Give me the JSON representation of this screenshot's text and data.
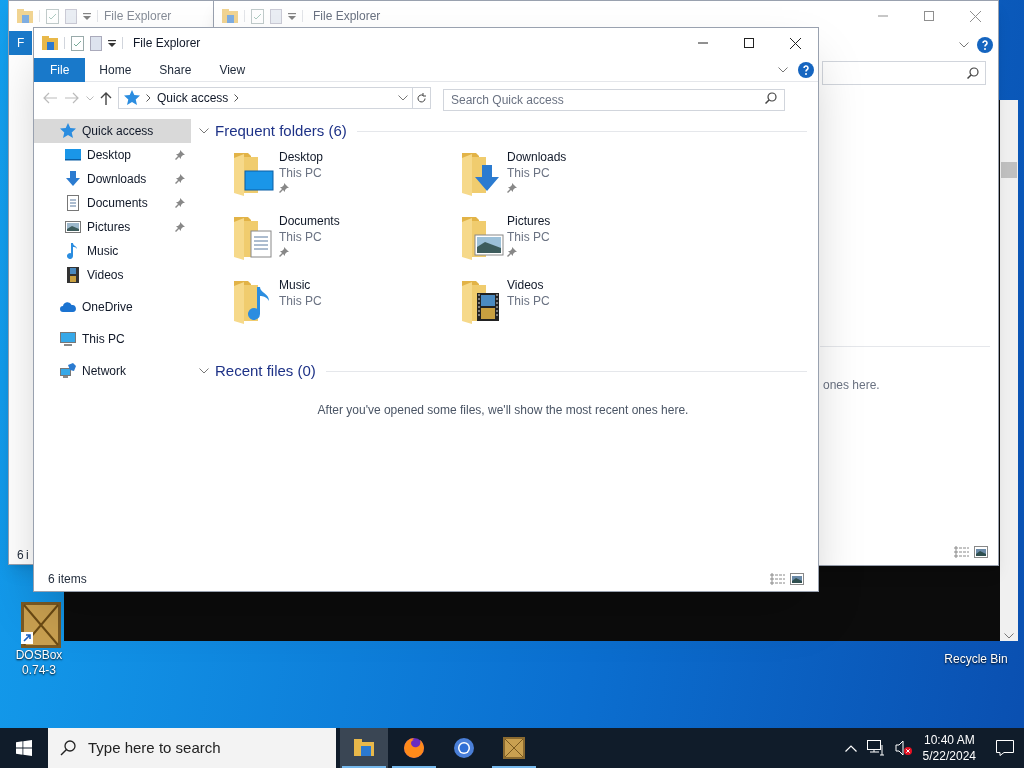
{
  "background_windows": [
    {
      "title": "File Explorer",
      "ribbon_tab": "F",
      "status": "6 i"
    },
    {
      "title": "File Explorer",
      "content_text": "ones here."
    }
  ],
  "window": {
    "title": "File Explorer"
  },
  "ribbon_tabs": [
    {
      "label": "File",
      "selected": true
    },
    {
      "label": "Home",
      "selected": false
    },
    {
      "label": "Share",
      "selected": false
    },
    {
      "label": "View",
      "selected": false
    }
  ],
  "address": {
    "path": "Quick access"
  },
  "search": {
    "placeholder": "Search Quick access"
  },
  "nav": [
    {
      "label": "Quick access",
      "kind": "quick",
      "selected": true,
      "children": [
        {
          "label": "Desktop",
          "kind": "desktop",
          "selected": false,
          "pinned": true
        },
        {
          "label": "Downloads",
          "kind": "downloads",
          "selected": false,
          "pinned": true
        },
        {
          "label": "Documents",
          "kind": "documents",
          "selected": false,
          "pinned": true
        },
        {
          "label": "Pictures",
          "kind": "pictures",
          "selected": false,
          "pinned": true
        },
        {
          "label": "Music",
          "kind": "music",
          "selected": false,
          "pinned": false
        },
        {
          "label": "Videos",
          "kind": "videos",
          "selected": false,
          "pinned": false
        }
      ]
    },
    {
      "label": "OneDrive",
      "kind": "cloud",
      "selected": false
    },
    {
      "label": "This PC",
      "kind": "pc",
      "selected": false
    },
    {
      "label": "Network",
      "kind": "network",
      "selected": false
    }
  ],
  "sections": [
    {
      "title": "Frequent folders (6)",
      "expanded": true,
      "folders": [
        {
          "name": "Desktop",
          "location": "This PC",
          "kind": "desktop",
          "pinned": true
        },
        {
          "name": "Downloads",
          "location": "This PC",
          "kind": "downloads",
          "pinned": true
        },
        {
          "name": "Documents",
          "location": "This PC",
          "kind": "documents",
          "pinned": true
        },
        {
          "name": "Pictures",
          "location": "This PC",
          "kind": "pictures",
          "pinned": true
        },
        {
          "name": "Music",
          "location": "This PC",
          "kind": "music",
          "pinned": false
        },
        {
          "name": "Videos",
          "location": "This PC",
          "kind": "videos",
          "pinned": false
        }
      ]
    },
    {
      "title": "Recent files (0)",
      "expanded": true,
      "message": "After you've opened some files, we'll show the most recent ones here."
    }
  ],
  "status_bar": "6 items",
  "desktop_icons": [
    {
      "label": "DOSBox 0.74-3",
      "kind": "dosbox"
    },
    {
      "label": "Recycle Bin",
      "kind": "recycle"
    }
  ],
  "taskbar": {
    "search_placeholder": "Type here to search",
    "apps": [
      {
        "kind": "explorer",
        "selected": true,
        "running": true
      },
      {
        "kind": "firefox",
        "selected": false,
        "running": true
      },
      {
        "kind": "chrome",
        "selected": false,
        "running": false
      },
      {
        "kind": "dosbox",
        "selected": false,
        "running": true
      }
    ],
    "time": "10:40 AM",
    "date": "5/22/2024"
  }
}
